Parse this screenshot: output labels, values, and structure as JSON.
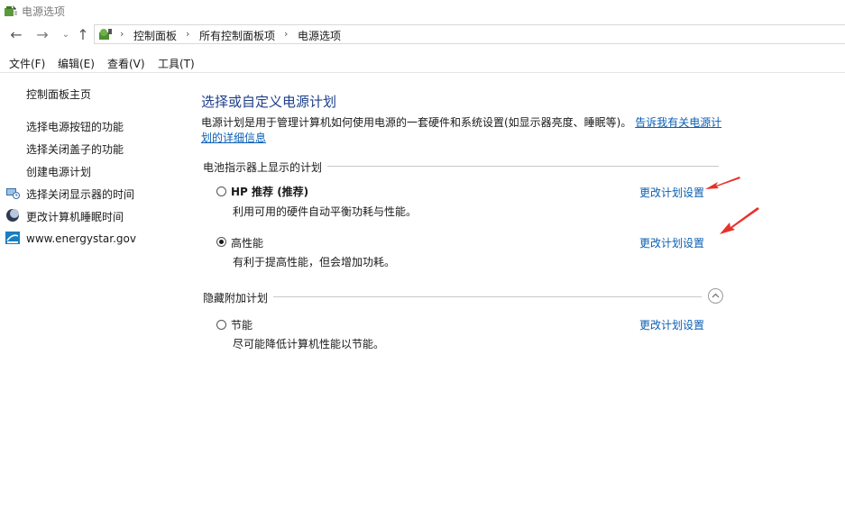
{
  "window": {
    "title": "电源选项"
  },
  "address": {
    "crumbs": [
      "控制面板",
      "所有控制面板项",
      "电源选项"
    ]
  },
  "menu": [
    "文件(F)",
    "编辑(E)",
    "查看(V)",
    "工具(T)"
  ],
  "sidebar": {
    "home": "控制面板主页",
    "links": [
      "选择电源按钮的功能",
      "选择关闭盖子的功能",
      "创建电源计划",
      "选择关闭显示器的时间",
      "更改计算机睡眠时间"
    ],
    "energystar": "www.energystar.gov"
  },
  "main": {
    "title": "选择或自定义电源计划",
    "description": "电源计划是用于管理计算机如何使用电源的一套硬件和系统设置(如显示器亮度、睡眠等)。",
    "description_link": "告诉我有关电源计划的详细信息",
    "battery_section": "电池指示器上显示的计划",
    "hidden_section": "隐藏附加计划",
    "plans": [
      {
        "name": "HP 推荐 (推荐)",
        "desc": "利用可用的硬件自动平衡功耗与性能。",
        "link": "更改计划设置",
        "selected": false
      },
      {
        "name": "高性能",
        "desc": "有利于提高性能，但会增加功耗。",
        "link": "更改计划设置",
        "selected": true
      },
      {
        "name": "节能",
        "desc": "尽可能降低计算机性能以节能。",
        "link": "更改计划设置",
        "selected": false
      }
    ]
  },
  "colors": {
    "link": "#0a5fb4",
    "title": "#1e3f8a",
    "annotation_arrow": "#e8312b"
  },
  "icons": [
    "power-options-icon",
    "back-arrow-icon",
    "forward-arrow-icon",
    "chevron-down-icon",
    "up-arrow-icon",
    "control-panel-icon",
    "monitor-clock-icon",
    "moon-icon",
    "energystar-icon",
    "collapse-chevron-icon"
  ]
}
